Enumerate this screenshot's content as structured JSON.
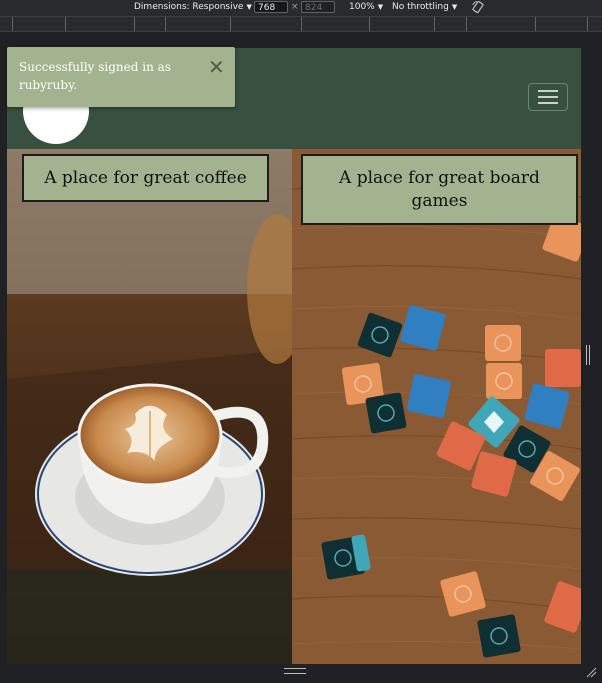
{
  "devtools": {
    "dimensions_label": "Dimensions: Responsive",
    "width_value": "768",
    "times": "×",
    "height_placeholder": "824",
    "zoom": "100%",
    "throttling": "No throttling",
    "rotate_icon": "rotate-icon"
  },
  "toast": {
    "message": "Successfully signed in as rubyruby.",
    "close_symbol": "✕",
    "color": "#a3b38f"
  },
  "navbar": {
    "color": "#37503f",
    "logo_icon": "logo-icon",
    "menu_icon": "hamburger-icon"
  },
  "panels": [
    {
      "caption": "A place for great coffee",
      "image": "coffee-latte-photo"
    },
    {
      "caption": "A place for great board games",
      "image": "board-game-tiles-photo"
    }
  ]
}
